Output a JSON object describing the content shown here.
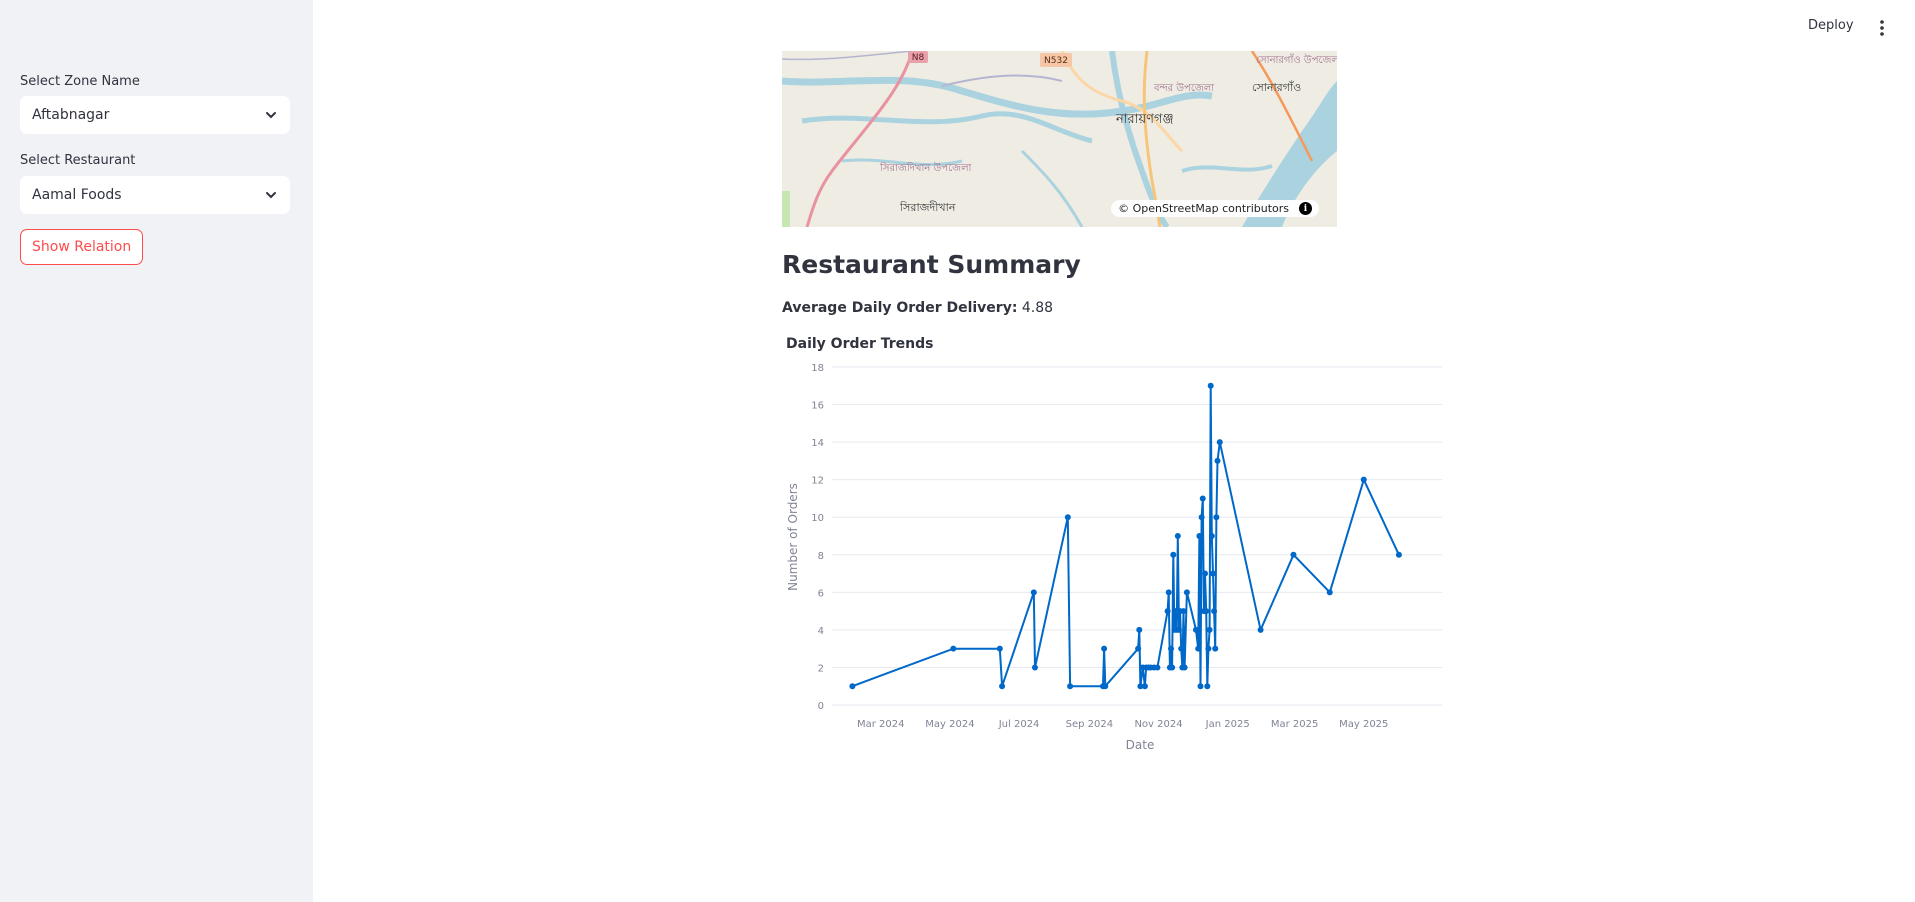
{
  "sidebar": {
    "zone_label": "Select Zone Name",
    "zone_value": "Aftabnagar",
    "restaurant_label": "Select Restaurant",
    "restaurant_value": "Aamal Foods",
    "show_relation_label": "Show Relation"
  },
  "header": {
    "deploy_label": "Deploy"
  },
  "map": {
    "labels": [
      "N8",
      "N532",
      "নারায়ণগঞ্জ",
      "সোনারগাঁও উপজেলা",
      "সোনারগাঁও",
      "বন্দর উপজেলা",
      "সিরাজদিখান উপজেলা",
      "সিরাজদীখান"
    ],
    "attribution": "© OpenStreetMap contributors",
    "info_icon": "info-icon"
  },
  "summary": {
    "title": "Restaurant Summary",
    "avg_label": "Average Daily Order Delivery:",
    "avg_value": "4.88"
  },
  "chart_data": {
    "type": "line",
    "title": "Daily Order Trends",
    "xlabel": "Date",
    "ylabel": "Number of Orders",
    "ylim": [
      0,
      18
    ],
    "yticks": [
      0,
      2,
      4,
      6,
      8,
      10,
      12,
      14,
      16,
      18
    ],
    "xlim": [
      "2024-01-18",
      "2025-07-09"
    ],
    "xticks": [
      {
        "date": "2024-03-01",
        "label": "Mar 2024"
      },
      {
        "date": "2024-05-01",
        "label": "May 2024"
      },
      {
        "date": "2024-07-01",
        "label": "Jul 2024"
      },
      {
        "date": "2024-09-01",
        "label": "Sep 2024"
      },
      {
        "date": "2024-11-01",
        "label": "Nov 2024"
      },
      {
        "date": "2025-01-01",
        "label": "Jan 2025"
      },
      {
        "date": "2025-03-01",
        "label": "Mar 2025"
      },
      {
        "date": "2025-05-01",
        "label": "May 2025"
      }
    ],
    "color": "#0068c9",
    "grid": true,
    "points": [
      [
        "2024-02-05",
        1
      ],
      [
        "2024-05-04",
        3
      ],
      [
        "2024-06-14",
        3
      ],
      [
        "2024-06-16",
        1
      ],
      [
        "2024-07-14",
        6
      ],
      [
        "2024-07-15",
        2
      ],
      [
        "2024-08-13",
        10
      ],
      [
        "2024-08-15",
        1
      ],
      [
        "2024-09-13",
        1
      ],
      [
        "2024-09-14",
        3
      ],
      [
        "2024-09-15",
        1
      ],
      [
        "2024-10-14",
        3
      ],
      [
        "2024-10-15",
        4
      ],
      [
        "2024-10-16",
        1
      ],
      [
        "2024-10-18",
        2
      ],
      [
        "2024-10-20",
        1
      ],
      [
        "2024-10-21",
        2
      ],
      [
        "2024-10-23",
        2
      ],
      [
        "2024-10-25",
        2
      ],
      [
        "2024-10-28",
        2
      ],
      [
        "2024-10-31",
        2
      ],
      [
        "2024-11-09",
        5
      ],
      [
        "2024-11-10",
        6
      ],
      [
        "2024-11-11",
        2
      ],
      [
        "2024-11-12",
        3
      ],
      [
        "2024-11-13",
        2
      ],
      [
        "2024-11-14",
        8
      ],
      [
        "2024-11-15",
        4
      ],
      [
        "2024-11-16",
        5
      ],
      [
        "2024-11-17",
        4
      ],
      [
        "2024-11-18",
        9
      ],
      [
        "2024-11-19",
        4
      ],
      [
        "2024-11-20",
        5
      ],
      [
        "2024-11-21",
        3
      ],
      [
        "2024-11-22",
        2
      ],
      [
        "2024-11-23",
        5
      ],
      [
        "2024-11-24",
        2
      ],
      [
        "2024-11-26",
        6
      ],
      [
        "2024-12-04",
        4
      ],
      [
        "2024-12-06",
        3
      ],
      [
        "2024-12-07",
        9
      ],
      [
        "2024-12-08",
        1
      ],
      [
        "2024-12-09",
        10
      ],
      [
        "2024-12-10",
        11
      ],
      [
        "2024-12-11",
        5
      ],
      [
        "2024-12-12",
        7
      ],
      [
        "2024-12-13",
        5
      ],
      [
        "2024-12-14",
        1
      ],
      [
        "2024-12-15",
        3
      ],
      [
        "2024-12-16",
        4
      ],
      [
        "2024-12-17",
        17
      ],
      [
        "2024-12-18",
        9
      ],
      [
        "2024-12-19",
        7
      ],
      [
        "2024-12-20",
        5
      ],
      [
        "2024-12-21",
        3
      ],
      [
        "2024-12-22",
        10
      ],
      [
        "2024-12-23",
        13
      ],
      [
        "2024-12-25",
        14
      ],
      [
        "2025-01-30",
        4
      ],
      [
        "2025-02-28",
        8
      ],
      [
        "2025-04-01",
        6
      ],
      [
        "2025-05-01",
        12
      ],
      [
        "2025-06-01",
        8
      ]
    ]
  }
}
